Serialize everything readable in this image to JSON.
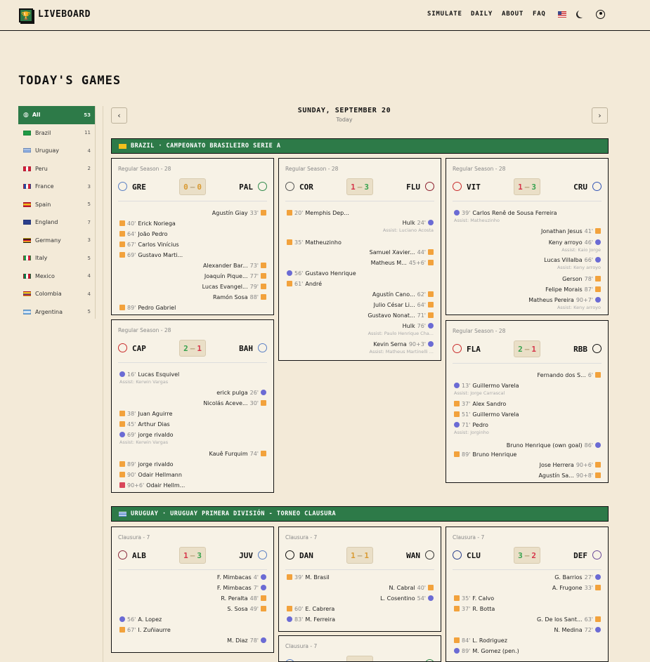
{
  "app": {
    "logo_text": "LIVEBOARD",
    "nav": [
      "SIMULATE",
      "DAILY",
      "ABOUT",
      "FAQ"
    ]
  },
  "page_title": "TODAY'S GAMES",
  "date": {
    "label": "SUNDAY, SEPTEMBER 20",
    "sub": "Today"
  },
  "sidebar": [
    {
      "label": "All",
      "count": "53",
      "active": true
    },
    {
      "label": "Brazil",
      "count": "11"
    },
    {
      "label": "Uruguay",
      "count": "4"
    },
    {
      "label": "Peru",
      "count": "2"
    },
    {
      "label": "France",
      "count": "3"
    },
    {
      "label": "Spain",
      "count": "5"
    },
    {
      "label": "England",
      "count": "7"
    },
    {
      "label": "Germany",
      "count": "3"
    },
    {
      "label": "Italy",
      "count": "5"
    },
    {
      "label": "Mexico",
      "count": "4"
    },
    {
      "label": "Colombia",
      "count": "4"
    },
    {
      "label": "Argentina",
      "count": "5"
    }
  ],
  "leagues": [
    {
      "name": "BRAZIL · CAMPEONATO BRASILEIRO SERIE A"
    },
    {
      "name": "URUGUAY · URUGUAY PRIMERA DIVISIÓN - TORNEO CLAUSURA"
    }
  ],
  "matches": [
    {
      "round": "Regular Season - 28",
      "home": "GRE",
      "away": "PAL",
      "score": "0 – 0",
      "events": [
        {
          "side": "a",
          "icon": "y",
          "player": "Agustín Giay",
          "min": "33'"
        },
        {
          "side": "h",
          "icon": "y",
          "player": "Erick Noriega",
          "min": "40'"
        },
        {
          "side": "h",
          "icon": "y",
          "player": "João Pedro",
          "min": "64'"
        },
        {
          "side": "h",
          "icon": "y",
          "player": "Carlos Vinícius",
          "min": "67'"
        },
        {
          "side": "h",
          "icon": "y",
          "player": "Gustavo Marti...",
          "min": "69'"
        },
        {
          "side": "a",
          "icon": "y",
          "player": "Alexander Bar...",
          "min": "73'"
        },
        {
          "side": "a",
          "icon": "y",
          "player": "Joaquín Pique...",
          "min": "77'"
        },
        {
          "side": "a",
          "icon": "y",
          "player": "Lucas Evangel...",
          "min": "79'"
        },
        {
          "side": "a",
          "icon": "y",
          "player": "Ramón Sosa",
          "min": "88'"
        },
        {
          "side": "h",
          "icon": "y",
          "player": "Pedro Gabriel",
          "min": "89'"
        }
      ]
    },
    {
      "round": "Regular Season - 28",
      "home": "COR",
      "away": "FLU",
      "score": "1 – 3",
      "events": [
        {
          "side": "h",
          "icon": "y",
          "player": "Memphis Dep...",
          "min": "20'"
        },
        {
          "side": "a",
          "icon": "g",
          "player": "Hulk",
          "min": "24'",
          "assist": "Assist: Luciano Acosta"
        },
        {
          "side": "h",
          "icon": "y",
          "player": "Matheuzinho",
          "min": "35'"
        },
        {
          "side": "a",
          "icon": "y",
          "player": "Samuel Xavier...",
          "min": "44'"
        },
        {
          "side": "a",
          "icon": "y",
          "player": "Matheus M...",
          "min": "45+6'"
        },
        {
          "side": "h",
          "icon": "g",
          "player": "Gustavo Henrique",
          "min": "56'"
        },
        {
          "side": "h",
          "icon": "y",
          "player": "André",
          "min": "61'"
        },
        {
          "side": "a",
          "icon": "y",
          "player": "Agustín Cano...",
          "min": "62'"
        },
        {
          "side": "a",
          "icon": "y",
          "player": "Julio César Li...",
          "min": "64'"
        },
        {
          "side": "a",
          "icon": "y",
          "player": "Gustavo Nonat...",
          "min": "71'"
        },
        {
          "side": "a",
          "icon": "g",
          "player": "Hulk",
          "min": "76'",
          "assist": "Assist: Paulo Henrique Cha..."
        },
        {
          "side": "a",
          "icon": "g",
          "player": "Kevin Serna",
          "min": "90+3'",
          "assist": "Assist: Matheus Martinelli ..."
        }
      ]
    },
    {
      "round": "Regular Season - 28",
      "home": "VIT",
      "away": "CRU",
      "score": "1 – 3",
      "events": [
        {
          "side": "h",
          "icon": "g",
          "player": "Carlos Renê de Sousa Ferreira",
          "min": "39'",
          "assist": "Assist: Matheuzinho"
        },
        {
          "side": "a",
          "icon": "y",
          "player": "Jonathan Jesus",
          "min": "41'"
        },
        {
          "side": "a",
          "icon": "g",
          "player": "Keny arroyo",
          "min": "46'",
          "assist": "Assist: Kaio Jorge"
        },
        {
          "side": "a",
          "icon": "g",
          "player": "Lucas Villalba",
          "min": "66'",
          "assist": "Assist: Keny arroyo"
        },
        {
          "side": "a",
          "icon": "y",
          "player": "Gerson",
          "min": "78'"
        },
        {
          "side": "a",
          "icon": "y",
          "player": "Felipe Morais",
          "min": "87'"
        },
        {
          "side": "a",
          "icon": "g",
          "player": "Matheus Pereira",
          "min": "90+7'",
          "assist": "Assist: Keny arroyo"
        }
      ]
    },
    {
      "round": "Regular Season - 28",
      "home": "CAP",
      "away": "BAH",
      "score": "2 – 1",
      "events": [
        {
          "side": "h",
          "icon": "g",
          "player": "Lucas Esquivel",
          "min": "16'",
          "assist": "Assist: Kerwin Vargas"
        },
        {
          "side": "a",
          "icon": "g",
          "player": "erick pulga",
          "min": "26'"
        },
        {
          "side": "a",
          "icon": "y",
          "player": "Nicolás Aceve...",
          "min": "30'"
        },
        {
          "side": "h",
          "icon": "y",
          "player": "Juan Aguirre",
          "min": "38'"
        },
        {
          "side": "h",
          "icon": "y",
          "player": "Arthur Dias",
          "min": "45'"
        },
        {
          "side": "h",
          "icon": "g",
          "player": "jorge rivaldo",
          "min": "69'",
          "assist": "Assist: Kerwin Vargas"
        },
        {
          "side": "a",
          "icon": "y",
          "player": "Kauê Furquim",
          "min": "74'"
        },
        {
          "side": "h",
          "icon": "y",
          "player": "jorge rivaldo",
          "min": "89'"
        },
        {
          "side": "h",
          "icon": "y",
          "player": "Odair Hellmann",
          "min": "90'"
        },
        {
          "side": "h",
          "icon": "r",
          "player": "Odair Hellm...",
          "min": "90+6'"
        }
      ]
    },
    {
      "round": "Regular Season - 28",
      "home": "FLA",
      "away": "RBB",
      "score": "2 – 1",
      "events": [
        {
          "side": "a",
          "icon": "y",
          "player": "Fernando dos S...",
          "min": "6'"
        },
        {
          "side": "h",
          "icon": "g",
          "player": "Guillermo Varela",
          "min": "13'",
          "assist": "Assist: Jorge Carrascal"
        },
        {
          "side": "h",
          "icon": "y",
          "player": "Alex Sandro",
          "min": "37'"
        },
        {
          "side": "h",
          "icon": "y",
          "player": "Guillermo Varela",
          "min": "51'"
        },
        {
          "side": "h",
          "icon": "g",
          "player": "Pedro",
          "min": "71'",
          "assist": "Assist: Jorginho"
        },
        {
          "side": "a",
          "icon": "g",
          "player": "Bruno Henrique (own goal)",
          "min": "86'"
        },
        {
          "side": "h",
          "icon": "y",
          "player": "Bruno Henrique",
          "min": "89'"
        },
        {
          "side": "a",
          "icon": "y",
          "player": "Jose Herrera",
          "min": "90+6'"
        },
        {
          "side": "a",
          "icon": "y",
          "player": "Agustín Sa...",
          "min": "90+8'"
        }
      ]
    },
    {
      "round": "Clausura - 7",
      "home": "ALB",
      "away": "JUV",
      "score": "1 – 3",
      "events": [
        {
          "side": "a",
          "icon": "g",
          "player": "F. Mimbacas",
          "min": "4'"
        },
        {
          "side": "a",
          "icon": "g",
          "player": "F. Mimbacas",
          "min": "7'"
        },
        {
          "side": "a",
          "icon": "y",
          "player": "R. Peralta",
          "min": "48'"
        },
        {
          "side": "a",
          "icon": "y",
          "player": "S. Sosa",
          "min": "49'"
        },
        {
          "side": "h",
          "icon": "g",
          "player": "A. Lopez",
          "min": "56'"
        },
        {
          "side": "h",
          "icon": "y",
          "player": "I. Zuñiaurre",
          "min": "67'"
        },
        {
          "side": "a",
          "icon": "g",
          "player": "M. Diaz",
          "min": "78'"
        }
      ]
    },
    {
      "round": "Clausura - 7",
      "home": "DAN",
      "away": "WAN",
      "score": "1 – 1",
      "events": [
        {
          "side": "h",
          "icon": "y",
          "player": "M. Brasil",
          "min": "39'"
        },
        {
          "side": "a",
          "icon": "y",
          "player": "N. Cabral",
          "min": "40'"
        },
        {
          "side": "a",
          "icon": "g",
          "player": "L. Cosentino",
          "min": "54'"
        },
        {
          "side": "h",
          "icon": "y",
          "player": "E. Cabrera",
          "min": "60'"
        },
        {
          "side": "h",
          "icon": "g",
          "player": "M. Ferreira",
          "min": "83'"
        }
      ]
    },
    {
      "round": "Clausura - 7",
      "home": "CLU",
      "away": "DEF",
      "score": "3 – 2",
      "events": [
        {
          "side": "a",
          "icon": "g",
          "player": "G. Barrios",
          "min": "27'"
        },
        {
          "side": "a",
          "icon": "y",
          "player": "A. Frugone",
          "min": "33'"
        },
        {
          "side": "h",
          "icon": "y",
          "player": "F. Calvo",
          "min": "35'"
        },
        {
          "side": "h",
          "icon": "y",
          "player": "R. Botta",
          "min": "37'"
        },
        {
          "side": "a",
          "icon": "y",
          "player": "G. De los Sant...",
          "min": "63'"
        },
        {
          "side": "a",
          "icon": "g",
          "player": "N. Medina",
          "min": "72'"
        },
        {
          "side": "h",
          "icon": "y",
          "player": "L. Rodriguez",
          "min": "84'"
        },
        {
          "side": "h",
          "icon": "g",
          "player": "M. Gomez (pen.)",
          "min": "89'"
        }
      ]
    },
    {
      "round": "Clausura - 7",
      "home": "",
      "away": "",
      "score": "",
      "events": []
    }
  ]
}
